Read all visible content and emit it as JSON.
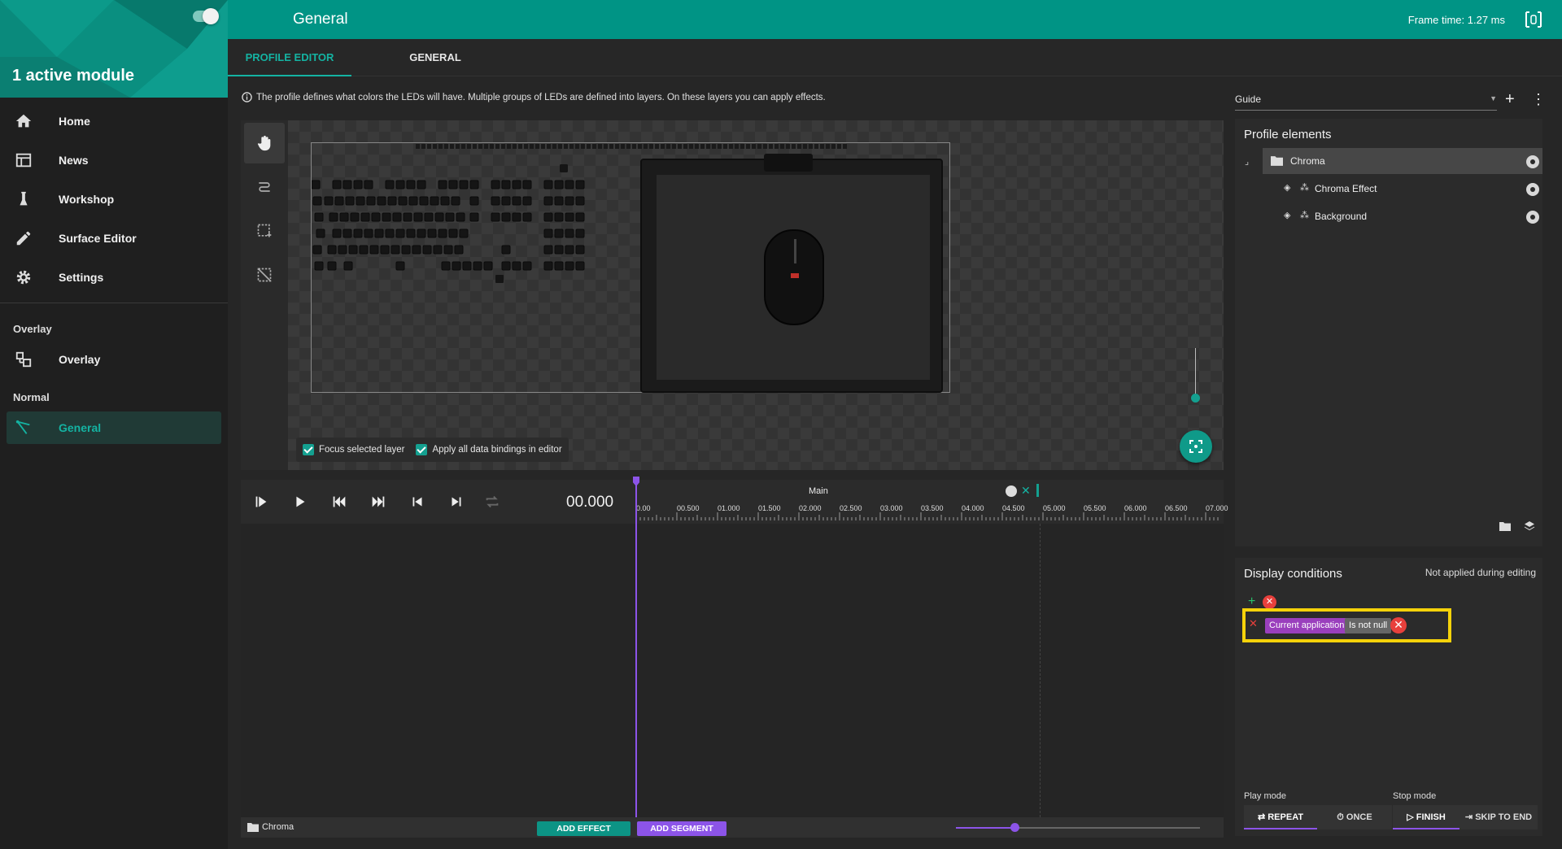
{
  "sidebar": {
    "module_count_label": "1 active module",
    "nav": [
      {
        "label": "Home",
        "icon": "home-icon"
      },
      {
        "label": "News",
        "icon": "news-icon"
      },
      {
        "label": "Workshop",
        "icon": "workshop-icon"
      },
      {
        "label": "Surface Editor",
        "icon": "pencil-icon"
      },
      {
        "label": "Settings",
        "icon": "gear-icon"
      }
    ],
    "sections": {
      "overlay_header": "Overlay",
      "overlay_item": "Overlay",
      "normal_header": "Normal",
      "general_item": "General"
    }
  },
  "header": {
    "title": "General",
    "frame_time": "Frame time: 1.27 ms"
  },
  "tabs": [
    "PROFILE EDITOR",
    "GENERAL"
  ],
  "editor": {
    "info_text": "The profile defines what colors the LEDs will have. Multiple groups of LEDs are defined into layers. On these layers you can apply effects.",
    "guide_value": "Guide",
    "focus_selected_label": "Focus selected layer",
    "apply_bindings_label": "Apply all data bindings in editor"
  },
  "timeline": {
    "time": "00.000",
    "segment_label": "Main",
    "ruler_ticks": [
      "0.00",
      "00.500",
      "01.000",
      "01.500",
      "02.000",
      "02.500",
      "03.000",
      "03.500",
      "04.000",
      "04.500",
      "05.000",
      "05.500",
      "06.000",
      "06.500",
      "07.000"
    ],
    "footer_layer": "Chroma",
    "add_effect": "ADD EFFECT",
    "add_segment": "ADD SEGMENT"
  },
  "profile_elements": {
    "title": "Profile elements",
    "items": [
      {
        "label": "Chroma"
      },
      {
        "label": "Chroma Effect"
      },
      {
        "label": "Background"
      }
    ]
  },
  "display_conditions": {
    "title": "Display conditions",
    "note": "Not applied during editing",
    "condition_left": "Current application",
    "condition_op": "Is not null",
    "play_mode_label": "Play mode",
    "stop_mode_label": "Stop mode",
    "play_modes": [
      "REPEAT",
      "ONCE"
    ],
    "stop_modes": [
      "FINISH",
      "SKIP TO END"
    ]
  },
  "colors": {
    "accent": "#009485",
    "purple": "#8c54e8",
    "highlight": "#f5d20a"
  }
}
